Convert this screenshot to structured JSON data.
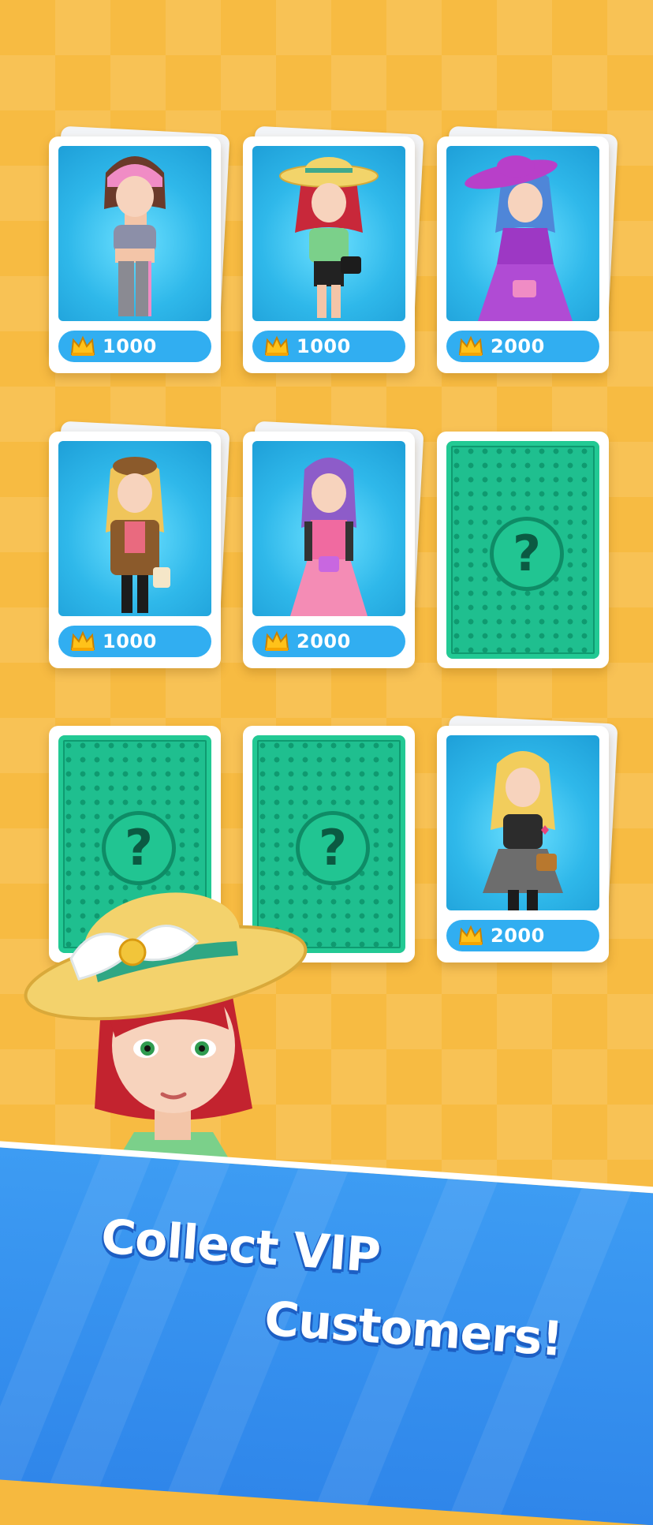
{
  "cards": [
    {
      "type": "customer",
      "price": "1000",
      "icon": "crown-icon",
      "accent": "#f08cc5"
    },
    {
      "type": "customer",
      "price": "1000",
      "icon": "crown-icon",
      "accent": "#e0c55a"
    },
    {
      "type": "customer",
      "price": "2000",
      "icon": "crown-icon",
      "accent": "#c34be0"
    },
    {
      "type": "customer",
      "price": "1000",
      "icon": "crown-icon",
      "accent": "#8b5a2b"
    },
    {
      "type": "customer",
      "price": "2000",
      "icon": "crown-icon",
      "accent": "#f06aa0"
    },
    {
      "type": "mystery",
      "symbol": "?",
      "icon": "question-mark-icon"
    },
    {
      "type": "mystery",
      "symbol": "?",
      "icon": "question-mark-icon"
    },
    {
      "type": "mystery",
      "symbol": "?",
      "icon": "question-mark-icon"
    },
    {
      "type": "customer",
      "price": "2000",
      "icon": "crown-icon",
      "accent": "#444444"
    }
  ],
  "banner": {
    "line1": "Collect VIP",
    "line2": "Customers!"
  },
  "colors": {
    "background": "#f7bb42",
    "pill": "#31aef1",
    "mystery_card": "#1fbf8f",
    "banner": "#3d9cf3"
  }
}
